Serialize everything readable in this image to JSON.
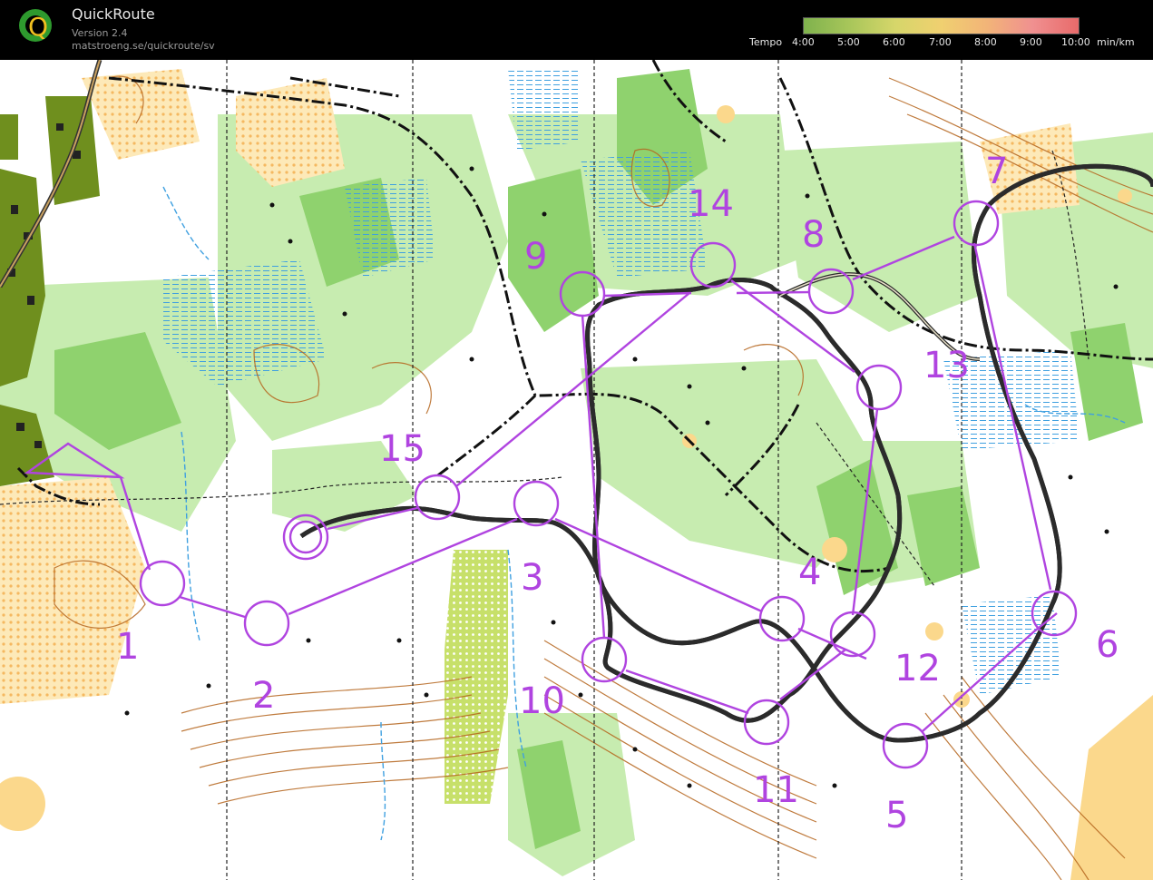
{
  "app": {
    "title": "QuickRoute",
    "version": "Version 2.4",
    "url": "matstroeng.se/quickroute/sv",
    "logo_letter": "Q"
  },
  "tempo": {
    "label": "Tempo",
    "ticks": [
      "4:00",
      "5:00",
      "6:00",
      "7:00",
      "8:00",
      "9:00",
      "10:00"
    ],
    "unit": "min/km",
    "colors": [
      "#7fb24d",
      "#a8c65a",
      "#d6d66a",
      "#f0d070",
      "#f2b478",
      "#f09090",
      "#e86a6a"
    ]
  },
  "map": {
    "colors": {
      "forest_green": "#8fd26e",
      "light_green": "#c7ecb0",
      "open_yellow": "#fbd88c",
      "dark_olive": "#6f8f1e",
      "contour_brown": "#b5651d",
      "marsh_blue": "#3fa0e0",
      "course_purple": "#b044e0",
      "route_black": "#222222"
    },
    "controls": [
      "1",
      "2",
      "3",
      "4",
      "5",
      "6",
      "7",
      "8",
      "9",
      "10",
      "11",
      "12",
      "13",
      "14",
      "15"
    ]
  }
}
